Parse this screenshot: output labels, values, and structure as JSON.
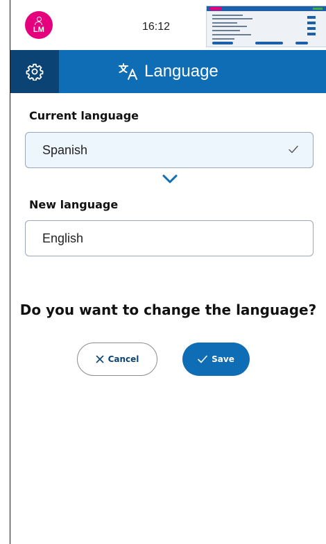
{
  "status_bar": {
    "user_initials": "LM",
    "time": "16:12"
  },
  "header": {
    "title": "Language",
    "icons": {
      "settings": "gear-icon",
      "title": "translate-icon"
    }
  },
  "current_language": {
    "label": "Current language",
    "value": "Spanish"
  },
  "new_language": {
    "label": "New language",
    "value": "English"
  },
  "confirm": {
    "question": "Do you want to change the language?",
    "cancel_label": "Cancel",
    "save_label": "Save"
  },
  "colors": {
    "brand_blue": "#0f6db5",
    "dark_blue": "#0b4474",
    "avatar_pink": "#e5007e"
  }
}
